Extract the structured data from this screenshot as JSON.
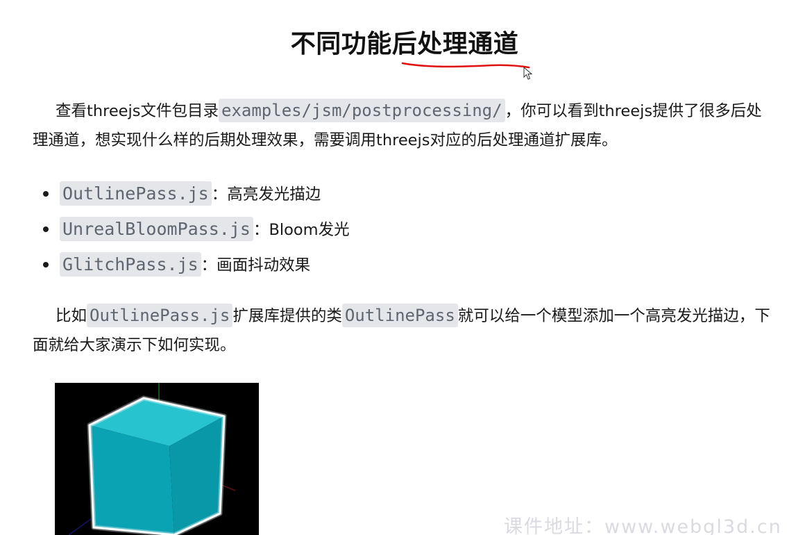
{
  "document": {
    "title": "不同功能后处理通道",
    "intro": {
      "before": "查看threejs文件包目录",
      "code": "examples/jsm/postprocessing/",
      "after": "，你可以看到threejs提供了很多后处理通道，想实现什么样的后期处理效果，需要调用threejs对应的后处理通道扩展库。"
    },
    "passes": [
      {
        "code": "OutlinePass.js",
        "desc": "：高亮发光描边"
      },
      {
        "code": "UnrealBloomPass.js",
        "desc": "：Bloom发光"
      },
      {
        "code": "GlitchPass.js",
        "desc": "：画面抖动效果"
      }
    ],
    "example": {
      "before": "比如",
      "code1": "OutlinePass.js",
      "middle": "扩展库提供的类",
      "code2": "OutlinePass",
      "after": "就可以给一个模型添加一个高亮发光描边，下面就给大家演示下如何实现。"
    },
    "demo_image": {
      "description_icon": "teal-cube-with-white-outline"
    }
  },
  "annotation": {
    "underline_color": "#e01010"
  },
  "watermark": "课件地址：www.webgl3d.cn",
  "colors": {
    "code_bg": "#e4e6ea",
    "code_text": "#5f6670",
    "cube_face": "#0aa3b3",
    "text": "#1a1a1a"
  }
}
